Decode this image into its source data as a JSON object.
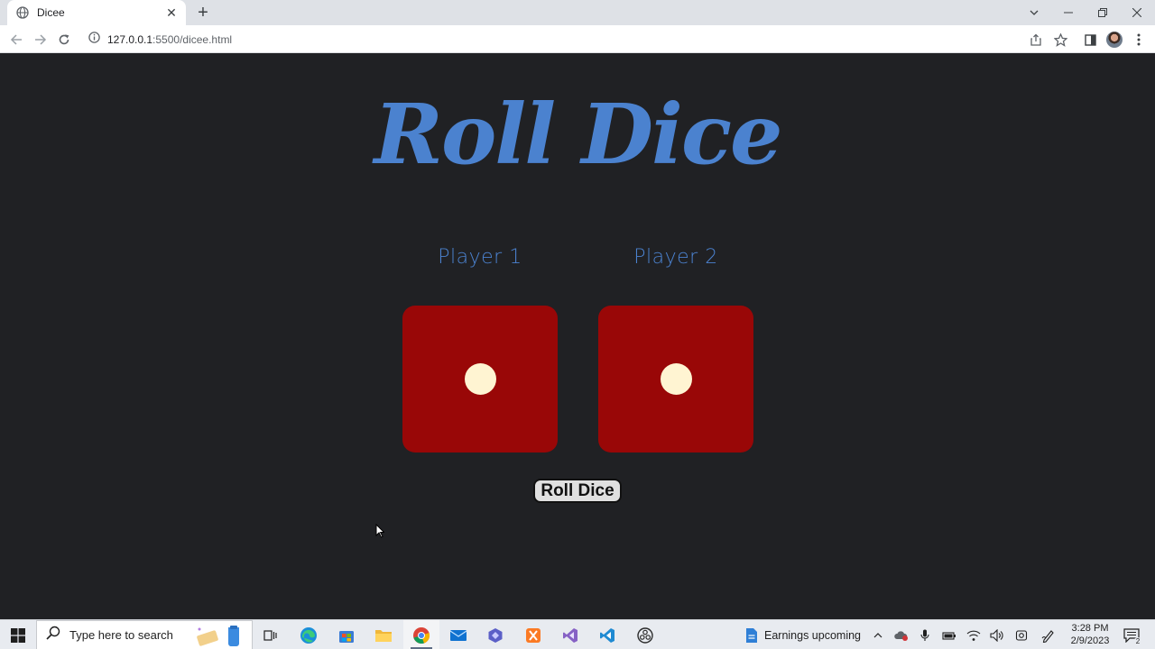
{
  "browser": {
    "tab_title": "Dicee",
    "url_host": "127.0.0.1",
    "url_rest": ":5500/dicee.html"
  },
  "page": {
    "heading": "Roll Dice",
    "players": [
      {
        "label": "Player 1",
        "die_value": 1
      },
      {
        "label": "Player 2",
        "die_value": 1
      }
    ],
    "roll_button": "Roll Dice",
    "colors": {
      "background": "#202124",
      "accent": "#4b82cf",
      "die": "#990707",
      "pip": "#fff4d2"
    }
  },
  "taskbar": {
    "search_placeholder": "Type here to search",
    "weather_text": "Earnings upcoming",
    "time": "3:28 PM",
    "date": "2/9/2023",
    "notification_count": "2"
  }
}
